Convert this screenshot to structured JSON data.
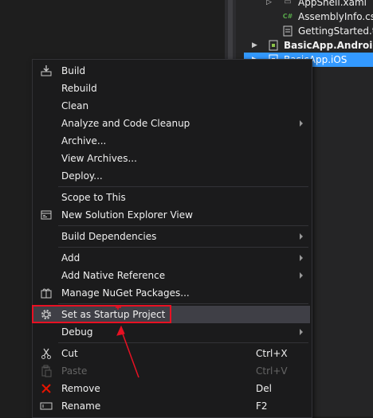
{
  "solution_explorer": {
    "items": [
      {
        "label": "AppShell.xaml",
        "icon": "xaml-file-icon"
      },
      {
        "label": "AssemblyInfo.cs",
        "icon": "csharp-file-icon"
      },
      {
        "label": "GettingStarted.txt",
        "icon": "text-file-icon"
      },
      {
        "label": "BasicApp.Android",
        "icon": "android-project-icon"
      },
      {
        "label": "BasicApp.iOS",
        "icon": "ios-project-icon"
      }
    ],
    "csharp_glyph": "C#"
  },
  "context_menu": {
    "items": [
      {
        "label": "Build",
        "icon": "build-icon"
      },
      {
        "label": "Rebuild"
      },
      {
        "label": "Clean"
      },
      {
        "label": "Analyze and Code Cleanup",
        "submenu": true
      },
      {
        "label": "Archive..."
      },
      {
        "label": "View Archives..."
      },
      {
        "label": "Deploy..."
      },
      {
        "label": "Scope to This"
      },
      {
        "label": "New Solution Explorer View",
        "icon": "new-view-icon"
      },
      {
        "label": "Build Dependencies",
        "submenu": true
      },
      {
        "label": "Add",
        "submenu": true
      },
      {
        "label": "Add Native Reference",
        "submenu": true
      },
      {
        "label": "Manage NuGet Packages...",
        "icon": "nuget-icon"
      },
      {
        "label": "Set as Startup Project",
        "icon": "gear-icon",
        "highlighted": true
      },
      {
        "label": "Debug",
        "submenu": true
      },
      {
        "label": "Cut",
        "shortcut": "Ctrl+X",
        "icon": "scissors-icon"
      },
      {
        "label": "Paste",
        "shortcut": "Ctrl+V",
        "icon": "paste-icon",
        "disabled": true
      },
      {
        "label": "Remove",
        "shortcut": "Del",
        "icon": "remove-icon"
      },
      {
        "label": "Rename",
        "shortcut": "F2",
        "icon": "rename-icon"
      }
    ]
  },
  "colors": {
    "background": "#1e1e1e",
    "menu_background": "#1b1b1c",
    "hover": "#3f3f46",
    "selection": "#3399ff",
    "annotation_red": "#e81123"
  }
}
